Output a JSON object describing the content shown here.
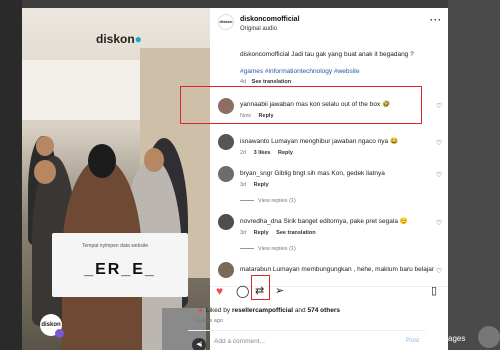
{
  "post": {
    "author": "diskoncomofficial",
    "audio": "Original audio",
    "caption_author": "diskoncomofficial",
    "caption_text": "Jadi tau gak yang buat anak it begadang ?",
    "hashtags": "#games #informationtechnology #website",
    "caption_age": "4d",
    "see_translation": "See translation"
  },
  "media": {
    "brand": "diskon",
    "card_small_text": "Tempat nyimpen data website",
    "card_big_text": "_ER_E_",
    "avatar_text": "diskon"
  },
  "comments": [
    {
      "user": "yannaabii",
      "text": "jawaban mas kon selalu out of the box 🤣",
      "age": "Now",
      "reply": "Reply",
      "likes": "",
      "translation": "",
      "view_replies": "",
      "avatar_color": "#8d6e63"
    },
    {
      "user": "isnawanto",
      "text": "Lumayan menghibur jawaban ngaco nya 😂",
      "age": "2d",
      "reply": "Reply",
      "likes": "3 likes",
      "translation": "",
      "view_replies": "",
      "avatar_color": "#555555"
    },
    {
      "user": "bryan_sngr",
      "text": "Giblig bngt sih mas Kon, gedek liatnya",
      "age": "3d",
      "reply": "Reply",
      "likes": "",
      "translation": "",
      "view_replies": "View replies (1)",
      "avatar_color": "#6d6d6d"
    },
    {
      "user": "novredha_dna",
      "text": "Sirik banget editornya, pake pret segala 😌",
      "age": "3d",
      "reply": "Reply",
      "likes": "",
      "translation": "See translation",
      "view_replies": "View replies (1)",
      "avatar_color": "#4e4e4e"
    },
    {
      "user": "matarabun",
      "text": "Lumayan membungungkan , hehe, maklum baru belajar",
      "age": "",
      "reply": "",
      "likes": "",
      "translation": "",
      "view_replies": "",
      "avatar_color": "#7a6a5a"
    }
  ],
  "actions": {
    "like_icon": "heart-filled-icon",
    "comment_icon": "comment-icon",
    "repost_icon": "repost-icon",
    "share_icon": "share-icon",
    "save_icon": "bookmark-icon",
    "like_color": "#ed4956"
  },
  "likes": {
    "prefix": "Liked by",
    "user": "resellercampofficial",
    "and": "and",
    "others": "574 others"
  },
  "posted_age": "4 days ago",
  "composer": {
    "placeholder": "Add a comment...",
    "post_label": "Post"
  },
  "background": {
    "partial_word": "ages"
  }
}
